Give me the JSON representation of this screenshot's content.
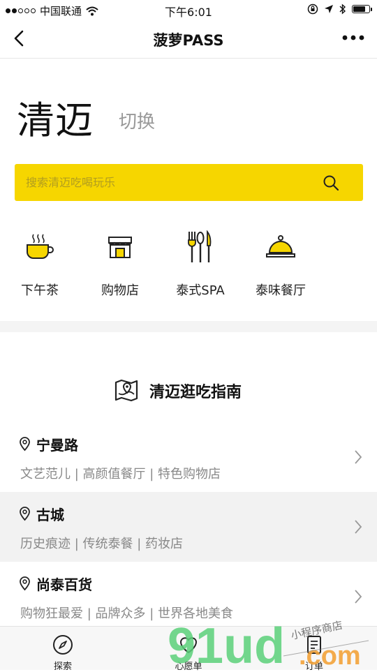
{
  "status_bar": {
    "carrier": "中国联通",
    "time": "下午6:01",
    "battery_level": 0.78
  },
  "nav": {
    "title": "菠萝PASS"
  },
  "city": {
    "name": "清迈",
    "switch_label": "切换"
  },
  "search": {
    "placeholder": "搜索清迈吃喝玩乐",
    "accent_color": "#f6d600"
  },
  "categories": [
    {
      "label": "下午茶",
      "icon": "teacup-icon"
    },
    {
      "label": "购物店",
      "icon": "storefront-icon"
    },
    {
      "label": "泰式SPA",
      "icon": "utensils-icon"
    },
    {
      "label": "泰味餐厅",
      "icon": "cloche-icon"
    }
  ],
  "guide": {
    "title": "清迈逛吃指南"
  },
  "areas": [
    {
      "name": "宁曼路",
      "tags": "文艺范儿 | 高颜值餐厅 | 特色购物店"
    },
    {
      "name": "古城",
      "tags": "历史痕迹 | 传统泰餐 | 药妆店"
    },
    {
      "name": "尚泰百货",
      "tags": "购物狂最爱 | 品牌众多 | 世界各地美食"
    }
  ],
  "tabs": [
    {
      "label": "探索",
      "icon": "compass-icon"
    },
    {
      "label": "心愿单",
      "icon": "heart-icon"
    },
    {
      "label": "订单",
      "icon": "order-icon"
    }
  ],
  "watermark": {
    "brand": "91ud",
    "domain": ".com",
    "subtitle": "小程序商店"
  }
}
